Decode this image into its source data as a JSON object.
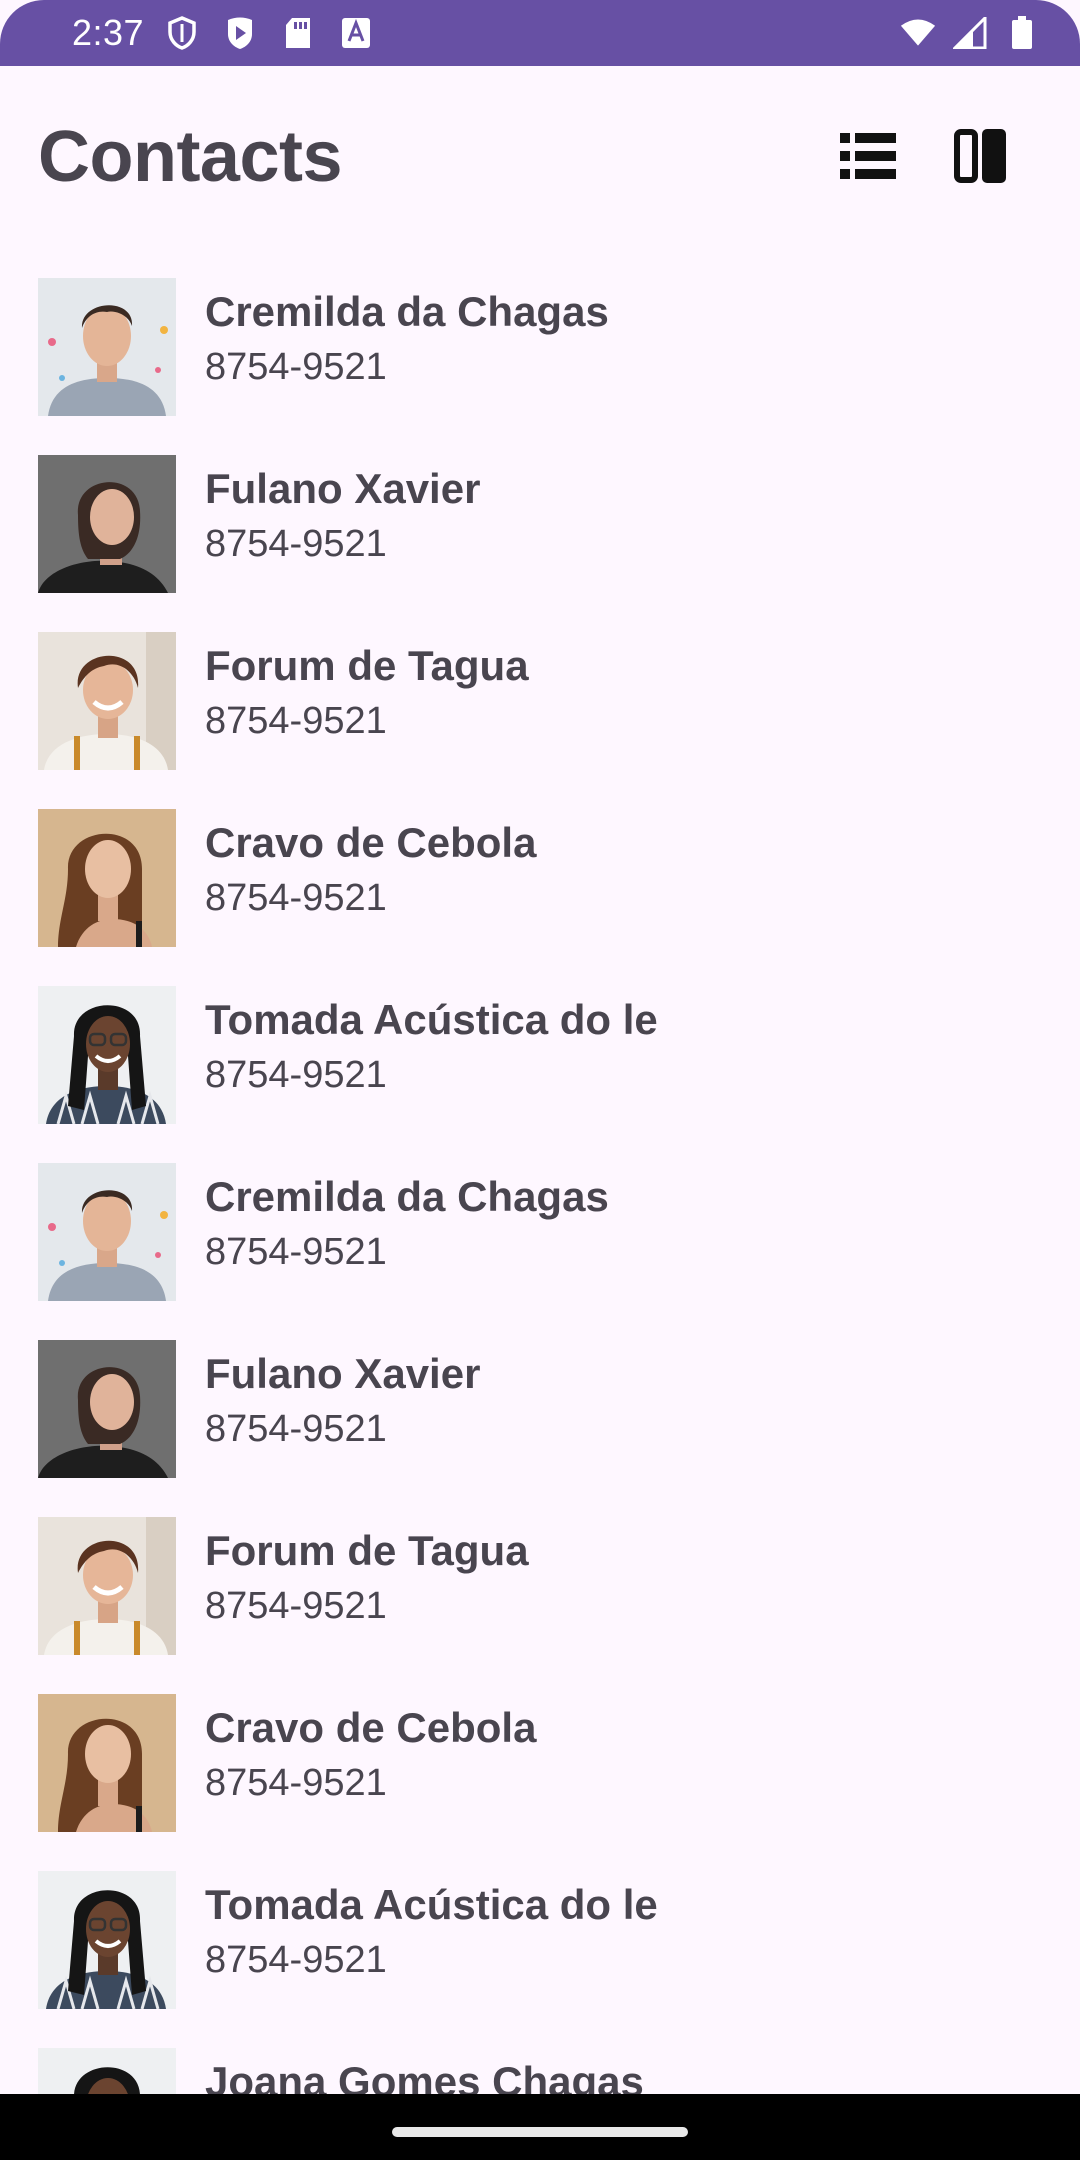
{
  "status_bar": {
    "time": "2:37",
    "left_icons": [
      "shield-icon",
      "play-store-icon",
      "sd-card-icon",
      "text-a-icon"
    ],
    "right_icons": [
      "wifi-icon",
      "cell-signal-icon",
      "battery-icon"
    ],
    "background": "#6750A4"
  },
  "header": {
    "title": "Contacts",
    "actions": [
      "list-view-icon",
      "split-view-icon"
    ]
  },
  "contacts": [
    {
      "name": "Cremilda da Chagas",
      "phone": "8754-9521",
      "avatar": "young-man-avatar"
    },
    {
      "name": "Fulano Xavier",
      "phone": "8754-9521",
      "avatar": "woman-dark-background-avatar"
    },
    {
      "name": "Forum de Tagua",
      "phone": "8754-9521",
      "avatar": "smiling-woman-short-hair-avatar"
    },
    {
      "name": "Cravo de Cebola",
      "phone": "8754-9521",
      "avatar": "woman-long-hair-avatar"
    },
    {
      "name": "Tomada Acústica do le",
      "phone": "8754-9521",
      "avatar": "woman-braids-glasses-avatar"
    },
    {
      "name": "Cremilda da Chagas",
      "phone": "8754-9521",
      "avatar": "young-man-avatar"
    },
    {
      "name": "Fulano Xavier",
      "phone": "8754-9521",
      "avatar": "woman-dark-background-avatar"
    },
    {
      "name": "Forum de Tagua",
      "phone": "8754-9521",
      "avatar": "smiling-woman-short-hair-avatar"
    },
    {
      "name": "Cravo de Cebola",
      "phone": "8754-9521",
      "avatar": "woman-long-hair-avatar"
    },
    {
      "name": "Tomada Acústica do le",
      "phone": "8754-9521",
      "avatar": "woman-braids-glasses-avatar"
    },
    {
      "name": "Joana Gomes Chagas",
      "phone": "",
      "avatar": "woman-braids-glasses-avatar"
    }
  ],
  "colors": {
    "background": "#FEF7FF",
    "text": "#49454F",
    "accent": "#6750A4"
  }
}
